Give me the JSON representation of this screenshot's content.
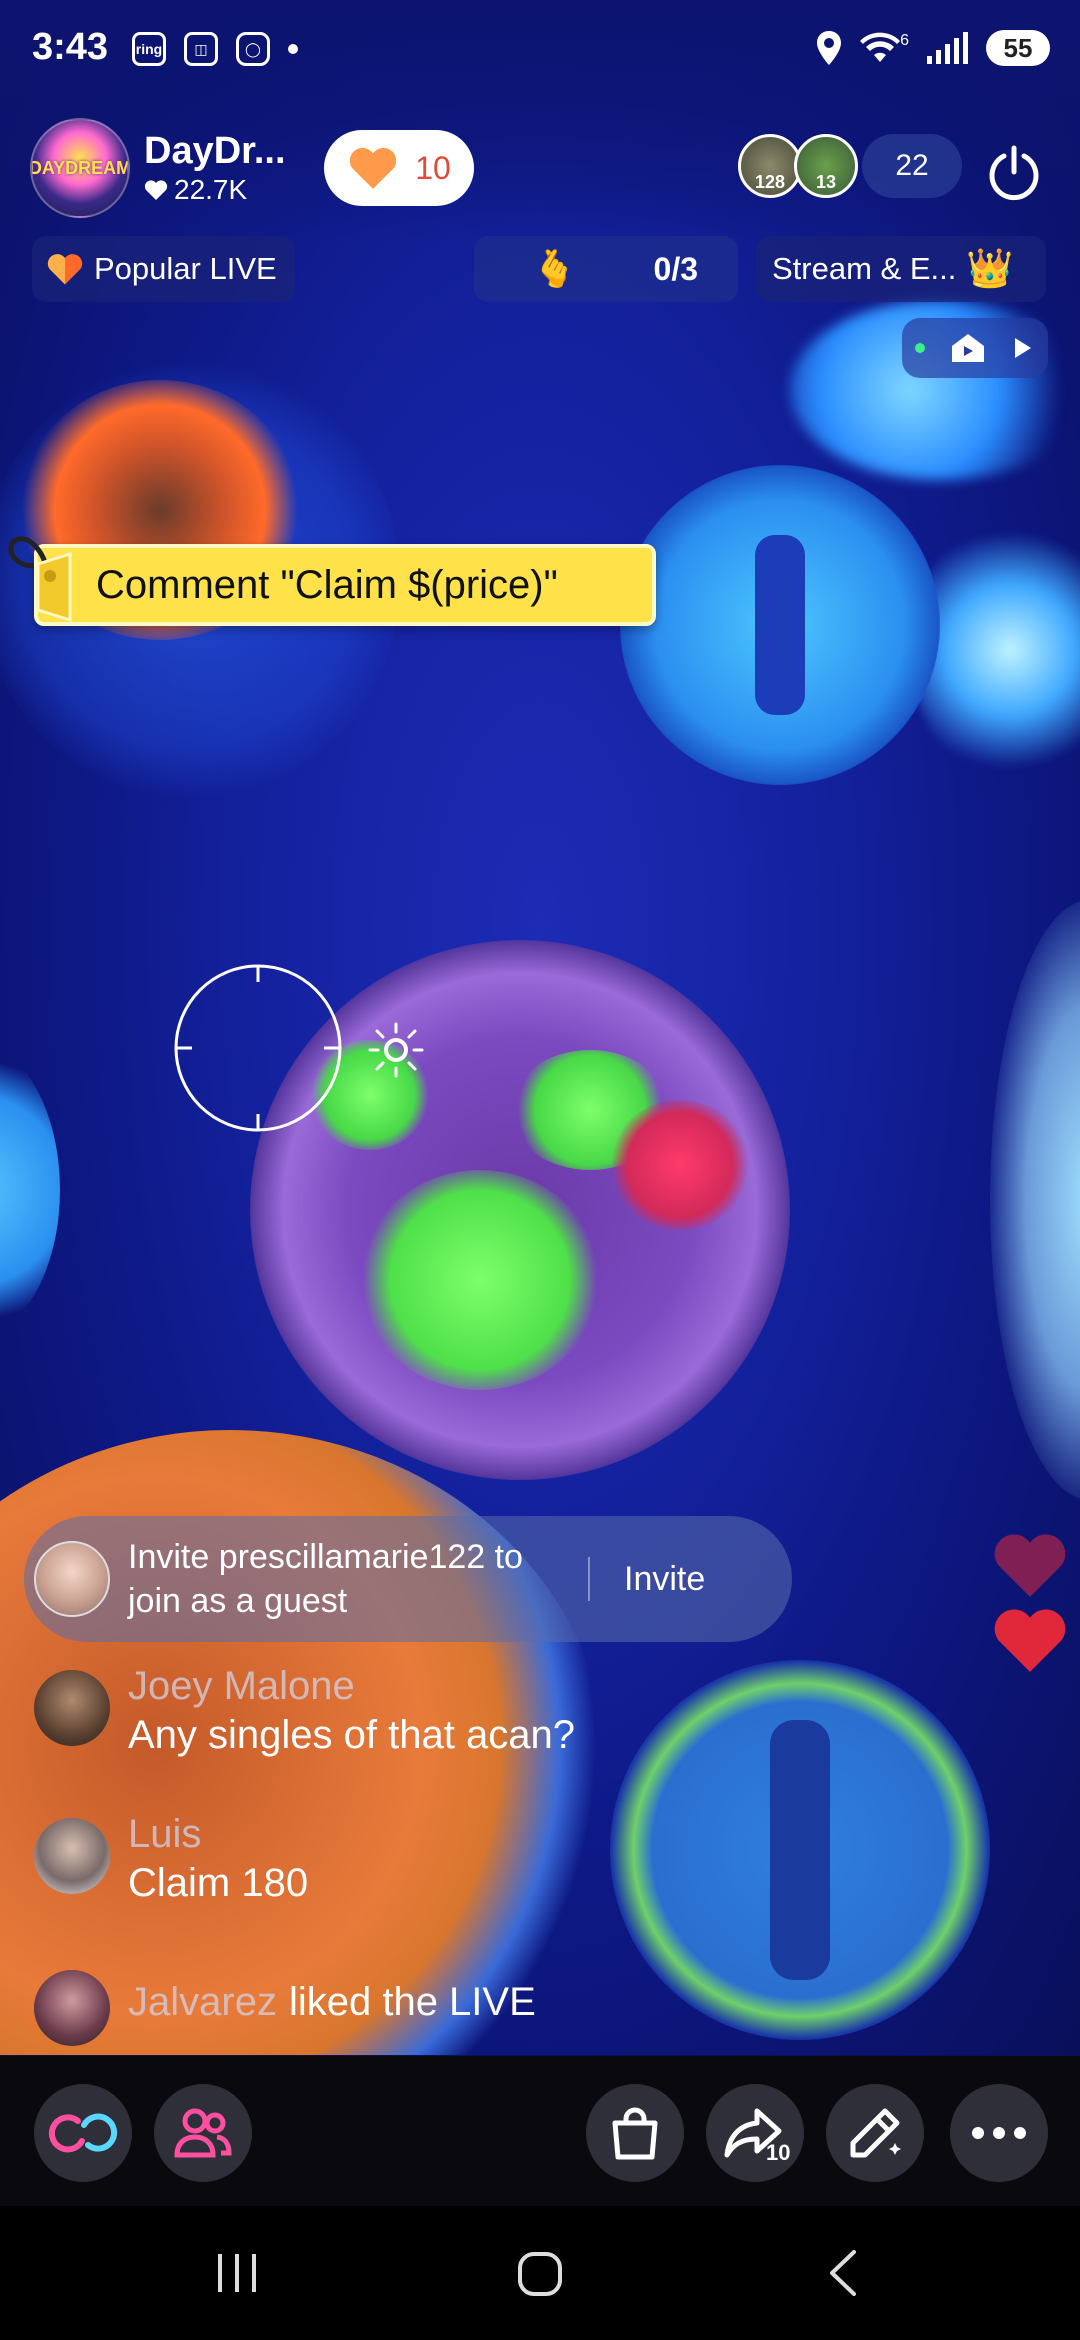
{
  "status_bar": {
    "time": "3:43",
    "left_icons": [
      "ring-icon",
      "capture-icon",
      "instagram-icon",
      "dot-icon"
    ],
    "ring_label": "ring",
    "wifi_label": "6",
    "battery": "55"
  },
  "host": {
    "avatar_text": "DAYDREAM",
    "name": "DayDr...",
    "likes": "22.7K",
    "follow_count": "10"
  },
  "viewers": {
    "avatar1_badge": "128",
    "avatar2_badge": "13",
    "count": "22"
  },
  "chips": {
    "popular": "Popular LIVE",
    "goal": "0/3",
    "stream": "Stream & E..."
  },
  "claim_banner": "Comment \"Claim $(price)\"",
  "invite": {
    "text": "Invite prescillamarie122 to join as a guest",
    "button": "Invite"
  },
  "chat": [
    {
      "name": "Joey Malone",
      "message": "Any singles of that acan?"
    },
    {
      "name": "Luis",
      "message": "Claim 180"
    },
    {
      "name": "Jalvarez",
      "message": "liked the LIVE"
    }
  ],
  "bottom_bar": {
    "share_badge": "10",
    "icons": [
      "link-guest-icon",
      "multi-guest-icon",
      "shop-icon",
      "share-icon",
      "effects-wand-icon",
      "more-icon"
    ]
  },
  "colors": {
    "accent_pink": "#ff4fa0",
    "heart_orange": "#ff9a4a",
    "banner_yellow": "#ffe14a",
    "heart_red": "#e0283a"
  }
}
